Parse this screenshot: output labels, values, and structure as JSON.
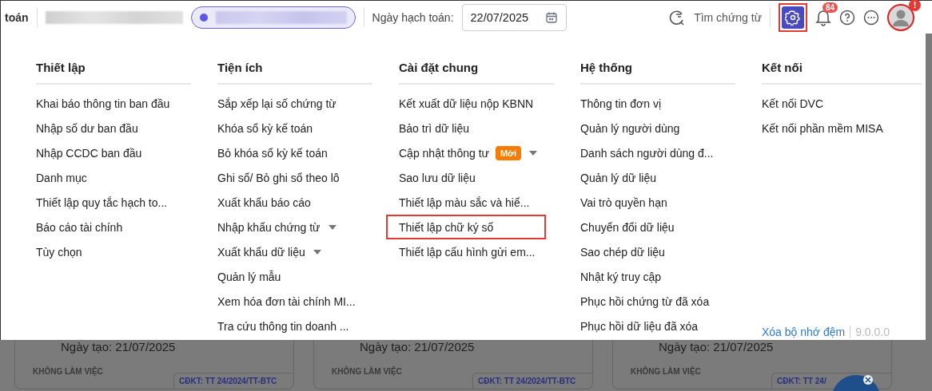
{
  "header": {
    "module_title": "toán",
    "date_label": "Ngày hạch toán:",
    "date_value": "22/07/2025",
    "search_label": "Tìm chứng từ",
    "settings_selected": true,
    "notification_count": "84",
    "avatar_alert": "!"
  },
  "menu": {
    "columns": [
      {
        "title": "Thiết lập",
        "items": [
          {
            "label": "Khai báo thông tin ban đầu",
            "has_submenu": false,
            "highlighted": false
          },
          {
            "label": "Nhập số dư ban đầu",
            "has_submenu": false,
            "highlighted": false
          },
          {
            "label": "Nhập CCDC ban đầu",
            "has_submenu": false,
            "highlighted": false
          },
          {
            "label": "Danh mục",
            "has_submenu": false,
            "highlighted": false
          },
          {
            "label": "Thiết lập quy tắc hạch to...",
            "has_submenu": false,
            "highlighted": false
          },
          {
            "label": "Báo cáo tài chính",
            "has_submenu": false,
            "highlighted": false
          },
          {
            "label": "Tùy chọn",
            "has_submenu": false,
            "highlighted": false
          }
        ]
      },
      {
        "title": "Tiện ích",
        "items": [
          {
            "label": "Sắp xếp lại số chứng từ",
            "has_submenu": false,
            "highlighted": false
          },
          {
            "label": "Khóa sổ kỳ kế toán",
            "has_submenu": false,
            "highlighted": false
          },
          {
            "label": "Bỏ khóa sổ kỳ kế toán",
            "has_submenu": false,
            "highlighted": false
          },
          {
            "label": "Ghi sổ/ Bỏ ghi sổ theo lô",
            "has_submenu": false,
            "highlighted": false
          },
          {
            "label": "Xuất khẩu báo cáo",
            "has_submenu": false,
            "highlighted": false
          },
          {
            "label": "Nhập khẩu chứng từ",
            "has_submenu": true,
            "highlighted": false
          },
          {
            "label": "Xuất khẩu dữ liệu",
            "has_submenu": true,
            "highlighted": false
          },
          {
            "label": "Quản lý mẫu",
            "has_submenu": false,
            "highlighted": false
          },
          {
            "label": "Xem hóa đơn tài chính MI...",
            "has_submenu": false,
            "highlighted": false
          },
          {
            "label": "Tra cứu thông tin doanh ...",
            "has_submenu": false,
            "highlighted": false
          }
        ]
      },
      {
        "title": "Cài đặt chung",
        "items": [
          {
            "label": "Kết xuất dữ liệu nộp KBNN",
            "has_submenu": false,
            "highlighted": false
          },
          {
            "label": "Bảo trì dữ liệu",
            "has_submenu": false,
            "highlighted": false
          },
          {
            "label": "Cập nhật thông tư",
            "badge": "Mới",
            "has_submenu": true,
            "highlighted": false
          },
          {
            "label": "Sao lưu dữ liệu",
            "has_submenu": false,
            "highlighted": false
          },
          {
            "label": "Thiết lập màu sắc và hiể...",
            "has_submenu": false,
            "highlighted": false
          },
          {
            "label": "Thiết lập chữ ký số",
            "has_submenu": false,
            "highlighted": true
          },
          {
            "label": "Thiết lập cấu hình gửi em...",
            "has_submenu": false,
            "highlighted": false
          }
        ]
      },
      {
        "title": "Hệ thống",
        "items": [
          {
            "label": "Thông tin đơn vị",
            "has_submenu": false,
            "highlighted": false
          },
          {
            "label": "Quản lý người dùng",
            "has_submenu": false,
            "highlighted": false
          },
          {
            "label": "Danh sách người dùng đ...",
            "has_submenu": false,
            "highlighted": false
          },
          {
            "label": "Quản lý dữ liệu",
            "has_submenu": false,
            "highlighted": false
          },
          {
            "label": "Vai trò quyền hạn",
            "has_submenu": false,
            "highlighted": false
          },
          {
            "label": "Chuyển đổi dữ liệu",
            "has_submenu": false,
            "highlighted": false
          },
          {
            "label": "Sao chép dữ liệu",
            "has_submenu": false,
            "highlighted": false
          },
          {
            "label": "Nhật ký truy cập",
            "has_submenu": false,
            "highlighted": false
          },
          {
            "label": "Phục hồi chứng từ đã xóa",
            "has_submenu": false,
            "highlighted": false
          },
          {
            "label": "Phục hồi dữ liệu đã xóa",
            "has_submenu": false,
            "highlighted": false
          }
        ]
      },
      {
        "title": "Kết nối",
        "items": [
          {
            "label": "Kết nối DVC",
            "has_submenu": false,
            "highlighted": false
          },
          {
            "label": "Kết nối phần mềm MISA",
            "has_submenu": false,
            "highlighted": false
          }
        ]
      }
    ],
    "clear_cache_link": "Xóa bộ nhớ đệm",
    "version": "9.0.0.0"
  },
  "background_cards": [
    {
      "created": "Ngày tạo: 21/07/2025",
      "status": "KHÔNG LÀM VIỆC",
      "regime": "CĐKT: TT 24/2024/TT-BTC"
    },
    {
      "created": "Ngày tạo: 21/07/2025",
      "status": "KHÔNG LÀM VIỆC",
      "regime": "CĐKT: TT 24/2024/TT-BTC"
    },
    {
      "created": "Ngày tạo: 21/07/2025",
      "status": "KHÔNG LÀM VIỆC",
      "regime": "CĐKT: TT 24/"
    }
  ]
}
